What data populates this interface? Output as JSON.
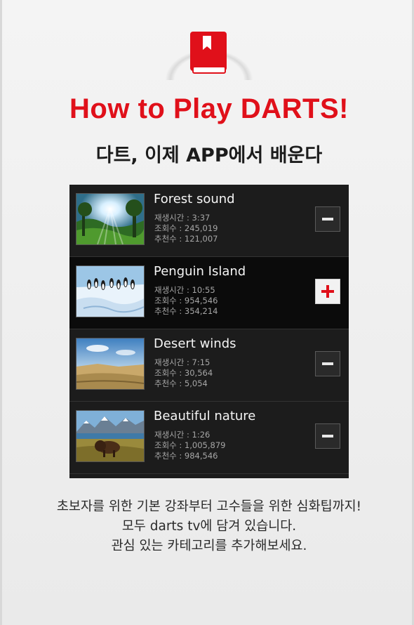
{
  "header": {
    "title": "How to Play DARTS!",
    "subtitle": "다트, 이제 APP에서 배운다",
    "logo_icon": "bookmark-book-icon",
    "accent_color": "#e0101a"
  },
  "videos": [
    {
      "title": "Forest sound",
      "play_time": "재생시간 : 3:37",
      "views": "조회수 : 245,019",
      "recommends": "추천수 : 121,007",
      "thumbnail": "forest-sunlight-image",
      "action": "remove",
      "action_icon": "minus-icon"
    },
    {
      "title": "Penguin Island",
      "play_time": "재생시간 : 10:55",
      "views": "조회수 : 954,546",
      "recommends": "추천수 : 354,214",
      "thumbnail": "penguins-on-ice-image",
      "action": "add",
      "action_icon": "plus-icon"
    },
    {
      "title": "Desert winds",
      "play_time": "재생시간 : 7:15",
      "views": "조회수 : 30,564",
      "recommends": "추천수 : 5,054",
      "thumbnail": "desert-landscape-image",
      "action": "remove",
      "action_icon": "minus-icon"
    },
    {
      "title": "Beautiful nature",
      "play_time": "재생시간 : 1:26",
      "views": "조회수 : 1,005,879",
      "recommends": "추천수 : 984,546",
      "thumbnail": "bison-mountain-lake-image",
      "action": "remove",
      "action_icon": "minus-icon"
    }
  ],
  "description": {
    "line1": "초보자를 위한 기본 강좌부터 고수들을 위한 심화팁까지!",
    "line2": "모두 darts tv에 담겨 있습니다.",
    "line3": "관심 있는 카테고리를 추가해보세요."
  }
}
